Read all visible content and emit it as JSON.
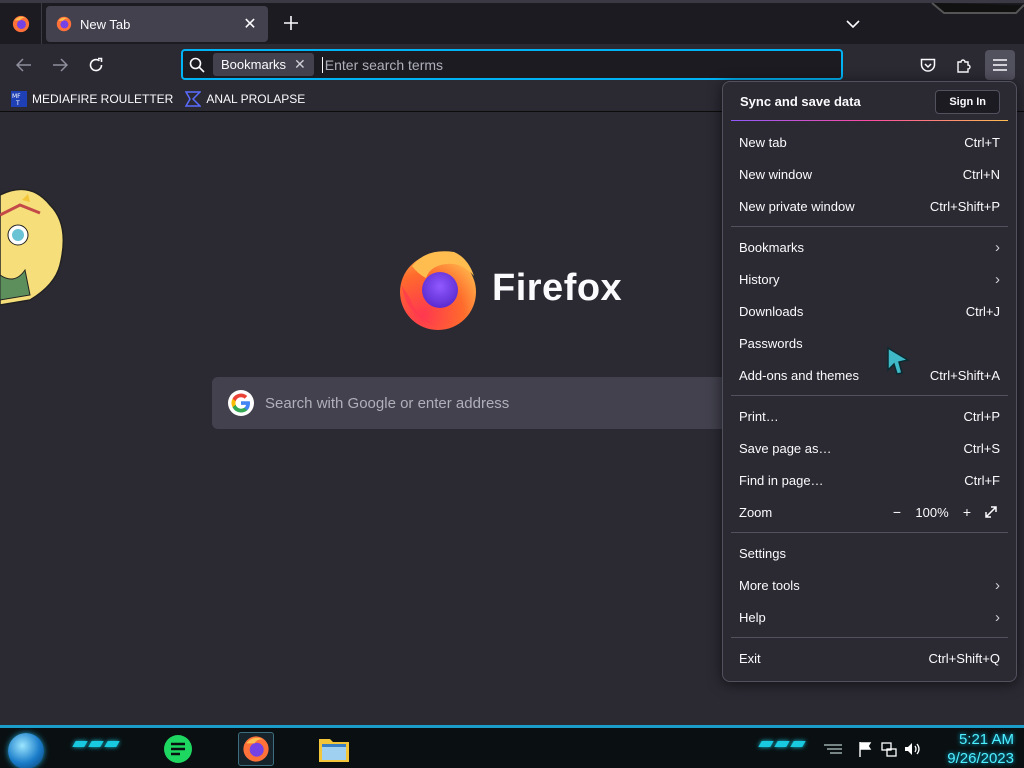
{
  "tab": {
    "title": "New Tab"
  },
  "urlbar": {
    "chip_label": "Bookmarks",
    "placeholder": "Enter search terms"
  },
  "bookmarks": [
    {
      "label": "MEDIAFIRE ROULETTER",
      "icon": "mediafire-icon"
    },
    {
      "label": "ANAL PROLAPSE",
      "icon": "bookmark-site-icon"
    }
  ],
  "newtab": {
    "brand": "Firefox",
    "search_placeholder": "Search with Google or enter address"
  },
  "menu": {
    "header_title": "Sync and save data",
    "sign_in": "Sign In",
    "groups": [
      [
        {
          "label": "New tab",
          "shortcut": "Ctrl+T"
        },
        {
          "label": "New window",
          "shortcut": "Ctrl+N"
        },
        {
          "label": "New private window",
          "shortcut": "Ctrl+Shift+P"
        }
      ],
      [
        {
          "label": "Bookmarks",
          "submenu": true
        },
        {
          "label": "History",
          "submenu": true
        },
        {
          "label": "Downloads",
          "shortcut": "Ctrl+J"
        },
        {
          "label": "Passwords",
          "shortcut": ""
        },
        {
          "label": "Add-ons and themes",
          "shortcut": "Ctrl+Shift+A"
        }
      ],
      [
        {
          "label": "Print…",
          "shortcut": "Ctrl+P"
        },
        {
          "label": "Save page as…",
          "shortcut": "Ctrl+S"
        },
        {
          "label": "Find in page…",
          "shortcut": "Ctrl+F"
        }
      ],
      [
        {
          "label": "Settings",
          "shortcut": ""
        },
        {
          "label": "More tools",
          "submenu": true
        },
        {
          "label": "Help",
          "submenu": true
        }
      ],
      [
        {
          "label": "Exit",
          "shortcut": "Ctrl+Shift+Q"
        }
      ]
    ],
    "zoom": {
      "label": "Zoom",
      "minus": "−",
      "value": "100%",
      "plus": "+"
    }
  },
  "taskbar": {
    "time": "5:21 AM",
    "date": "9/26/2023"
  },
  "colors": {
    "accent": "#00b3f4",
    "taskbar_glow": "#18c9e0",
    "clock": "#4ef0ff"
  }
}
